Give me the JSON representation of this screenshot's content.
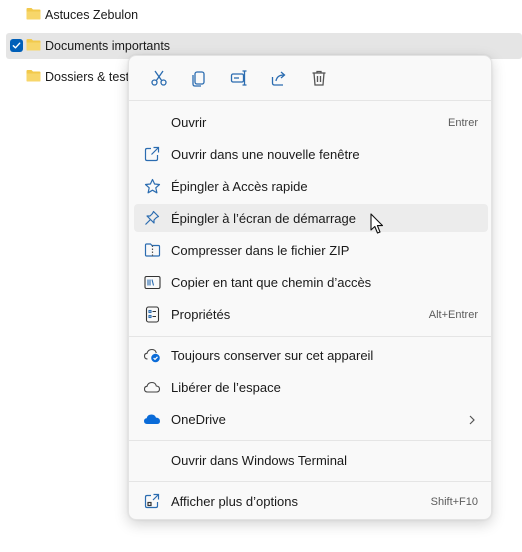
{
  "file_list": {
    "rows": [
      {
        "name": "Astuces Zebulon",
        "selected": false
      },
      {
        "name": "Documents importants",
        "selected": true
      },
      {
        "name": "Dossiers & tests",
        "selected": false
      }
    ]
  },
  "context_menu": {
    "quick_actions": [
      {
        "icon": "cut-icon",
        "tooltip": "Couper"
      },
      {
        "icon": "copy-icon",
        "tooltip": "Copier"
      },
      {
        "icon": "rename-icon",
        "tooltip": "Renommer"
      },
      {
        "icon": "share-icon",
        "tooltip": "Partager"
      },
      {
        "icon": "delete-icon",
        "tooltip": "Supprimer"
      }
    ],
    "items": {
      "open": {
        "label": "Ouvrir",
        "shortcut": "Entrer"
      },
      "open_new_window": {
        "label": "Ouvrir dans une nouvelle fenêtre",
        "icon": "open-new-window-icon"
      },
      "pin_quick_access": {
        "label": "Épingler à Accès rapide",
        "icon": "star-icon"
      },
      "pin_start": {
        "label": "Épingler à l’écran de démarrage",
        "icon": "pin-icon"
      },
      "compress_zip": {
        "label": "Compresser dans le fichier ZIP",
        "icon": "zip-icon"
      },
      "copy_path": {
        "label": "Copier en tant que chemin d’accès",
        "icon": "copy-path-icon"
      },
      "properties": {
        "label": "Propriétés",
        "shortcut": "Alt+Entrer",
        "icon": "properties-icon"
      },
      "always_keep": {
        "label": "Toujours conserver sur cet appareil",
        "icon": "cloud-sync-icon"
      },
      "free_space": {
        "label": "Libérer de l’espace",
        "icon": "cloud-outline-icon"
      },
      "onedrive": {
        "label": "OneDrive",
        "icon": "onedrive-icon"
      },
      "open_terminal": {
        "label": "Ouvrir dans Windows Terminal"
      },
      "more_options": {
        "label": "Afficher plus d’options",
        "shortcut": "Shift+F10",
        "icon": "more-options-icon"
      }
    }
  },
  "colors": {
    "accent": "#005fb8",
    "onedrive_blue": "#0a6bd8",
    "folder_yellow": "#f2c94c"
  }
}
